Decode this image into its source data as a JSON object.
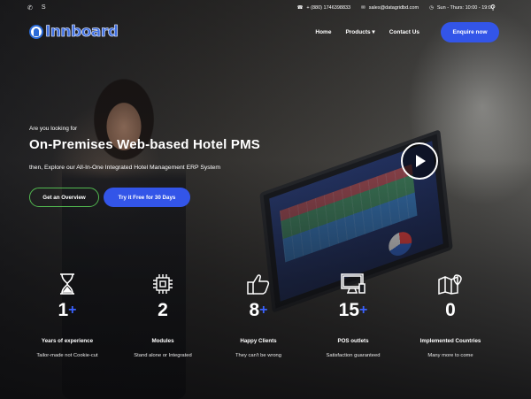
{
  "topbar": {
    "social": [
      {
        "icon": "whatsapp-icon",
        "glyph": "✆"
      },
      {
        "icon": "skype-icon",
        "glyph": "S"
      }
    ],
    "phone": "+ (880) 1746398833",
    "email": "sales@datagridbd.com",
    "hours": "Sun - Thurs: 10:00 - 19:00"
  },
  "nav": {
    "logo_text": "Innboard",
    "items": [
      {
        "label": "Home"
      },
      {
        "label": "Products ▾"
      },
      {
        "label": "Contact Us"
      }
    ],
    "cta": "Enquire now",
    "accent": "#3355e8"
  },
  "hero": {
    "pre": "Are you looking for",
    "title": "On-Premises Web-based Hotel PMS",
    "sub": "then, Explore our All-In-One Integrated Hotel Management ERP System",
    "btn_outline": "Get an Overview",
    "btn_primary": "Try it Free for 30 Days"
  },
  "stats": [
    {
      "icon": "hourglass-icon",
      "value": "1",
      "plus": "+",
      "label": "Years of experience",
      "desc": "Tailor-made not Cookie-cut"
    },
    {
      "icon": "chip-icon",
      "value": "2",
      "plus": "",
      "label": "Modules",
      "desc": "Stand alone or Integrated"
    },
    {
      "icon": "thumbs-up-icon",
      "value": "8",
      "plus": "+",
      "label": "Happy Clients",
      "desc": "They can't be wrong"
    },
    {
      "icon": "monitor-icon",
      "value": "15",
      "plus": "+",
      "label": "POS outlets",
      "desc": "Satisfaction guaranteed"
    },
    {
      "icon": "map-icon",
      "value": "0",
      "plus": "",
      "label": "Implemented Countries",
      "desc": "Many more to come"
    }
  ]
}
